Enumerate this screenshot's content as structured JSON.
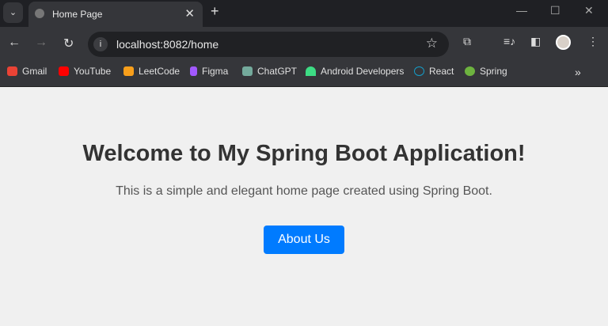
{
  "tab": {
    "title": "Home Page"
  },
  "address": {
    "url": "localhost:8082/home"
  },
  "bookmarks": [
    {
      "label": "Gmail",
      "color": "#ea4335"
    },
    {
      "label": "YouTube",
      "color": "#ff0000"
    },
    {
      "label": "LeetCode",
      "color": "#f89f1b"
    },
    {
      "label": "Figma",
      "color": "#a259ff"
    },
    {
      "label": "ChatGPT",
      "color": "#74aa9c"
    },
    {
      "label": "Android Developers",
      "color": "#3ddc84"
    },
    {
      "label": "React",
      "color": "#149eca"
    },
    {
      "label": "Spring",
      "color": "#6db33f"
    }
  ],
  "page": {
    "heading": "Welcome to My Spring Boot Application!",
    "subtitle": "This is a simple and elegant home page created using Spring Boot.",
    "button": "About Us"
  }
}
